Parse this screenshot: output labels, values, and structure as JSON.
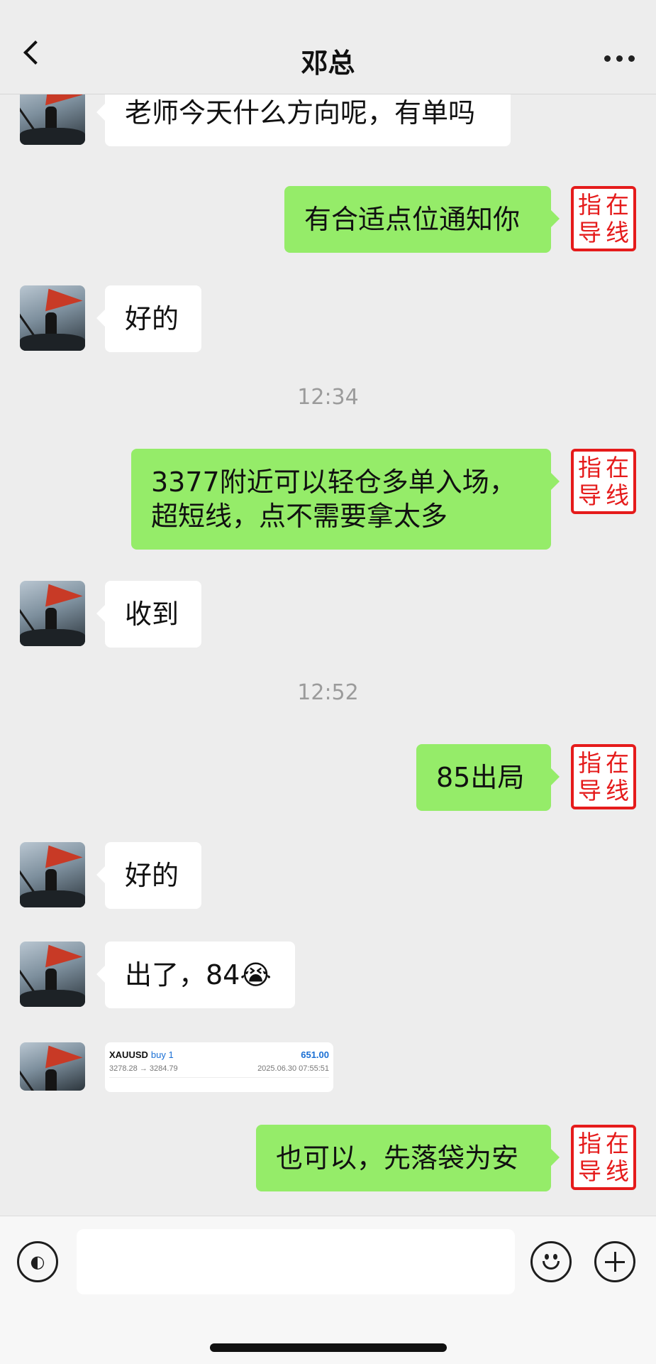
{
  "header": {
    "title": "邓总"
  },
  "seal_text": [
    "指",
    "在",
    "导",
    "线"
  ],
  "messages": {
    "m1": "老师今天什么方向呢，有单吗",
    "m2": "有合适点位通知你",
    "m3": "好的",
    "t1": "12:34",
    "m4_line1": "3377附近可以轻仓多单入场，",
    "m4_line2": "超短线，点不需要拿太多",
    "m5": "收到",
    "t2": "12:52",
    "m6": "85出局",
    "m7": "好的",
    "m8": "出了，84😭",
    "m10": "也可以，先落袋为安"
  },
  "trade": {
    "symbol": "XAUUSD",
    "side": "buy 1",
    "profit": "651.00",
    "prices": "3278.28 → 3284.79",
    "time": "2025.06.30 07:55:51"
  },
  "input": {
    "placeholder": "",
    "voice_icon": "voice-icon",
    "emoji_icon": "emoji-icon",
    "plus_icon": "plus-icon"
  }
}
